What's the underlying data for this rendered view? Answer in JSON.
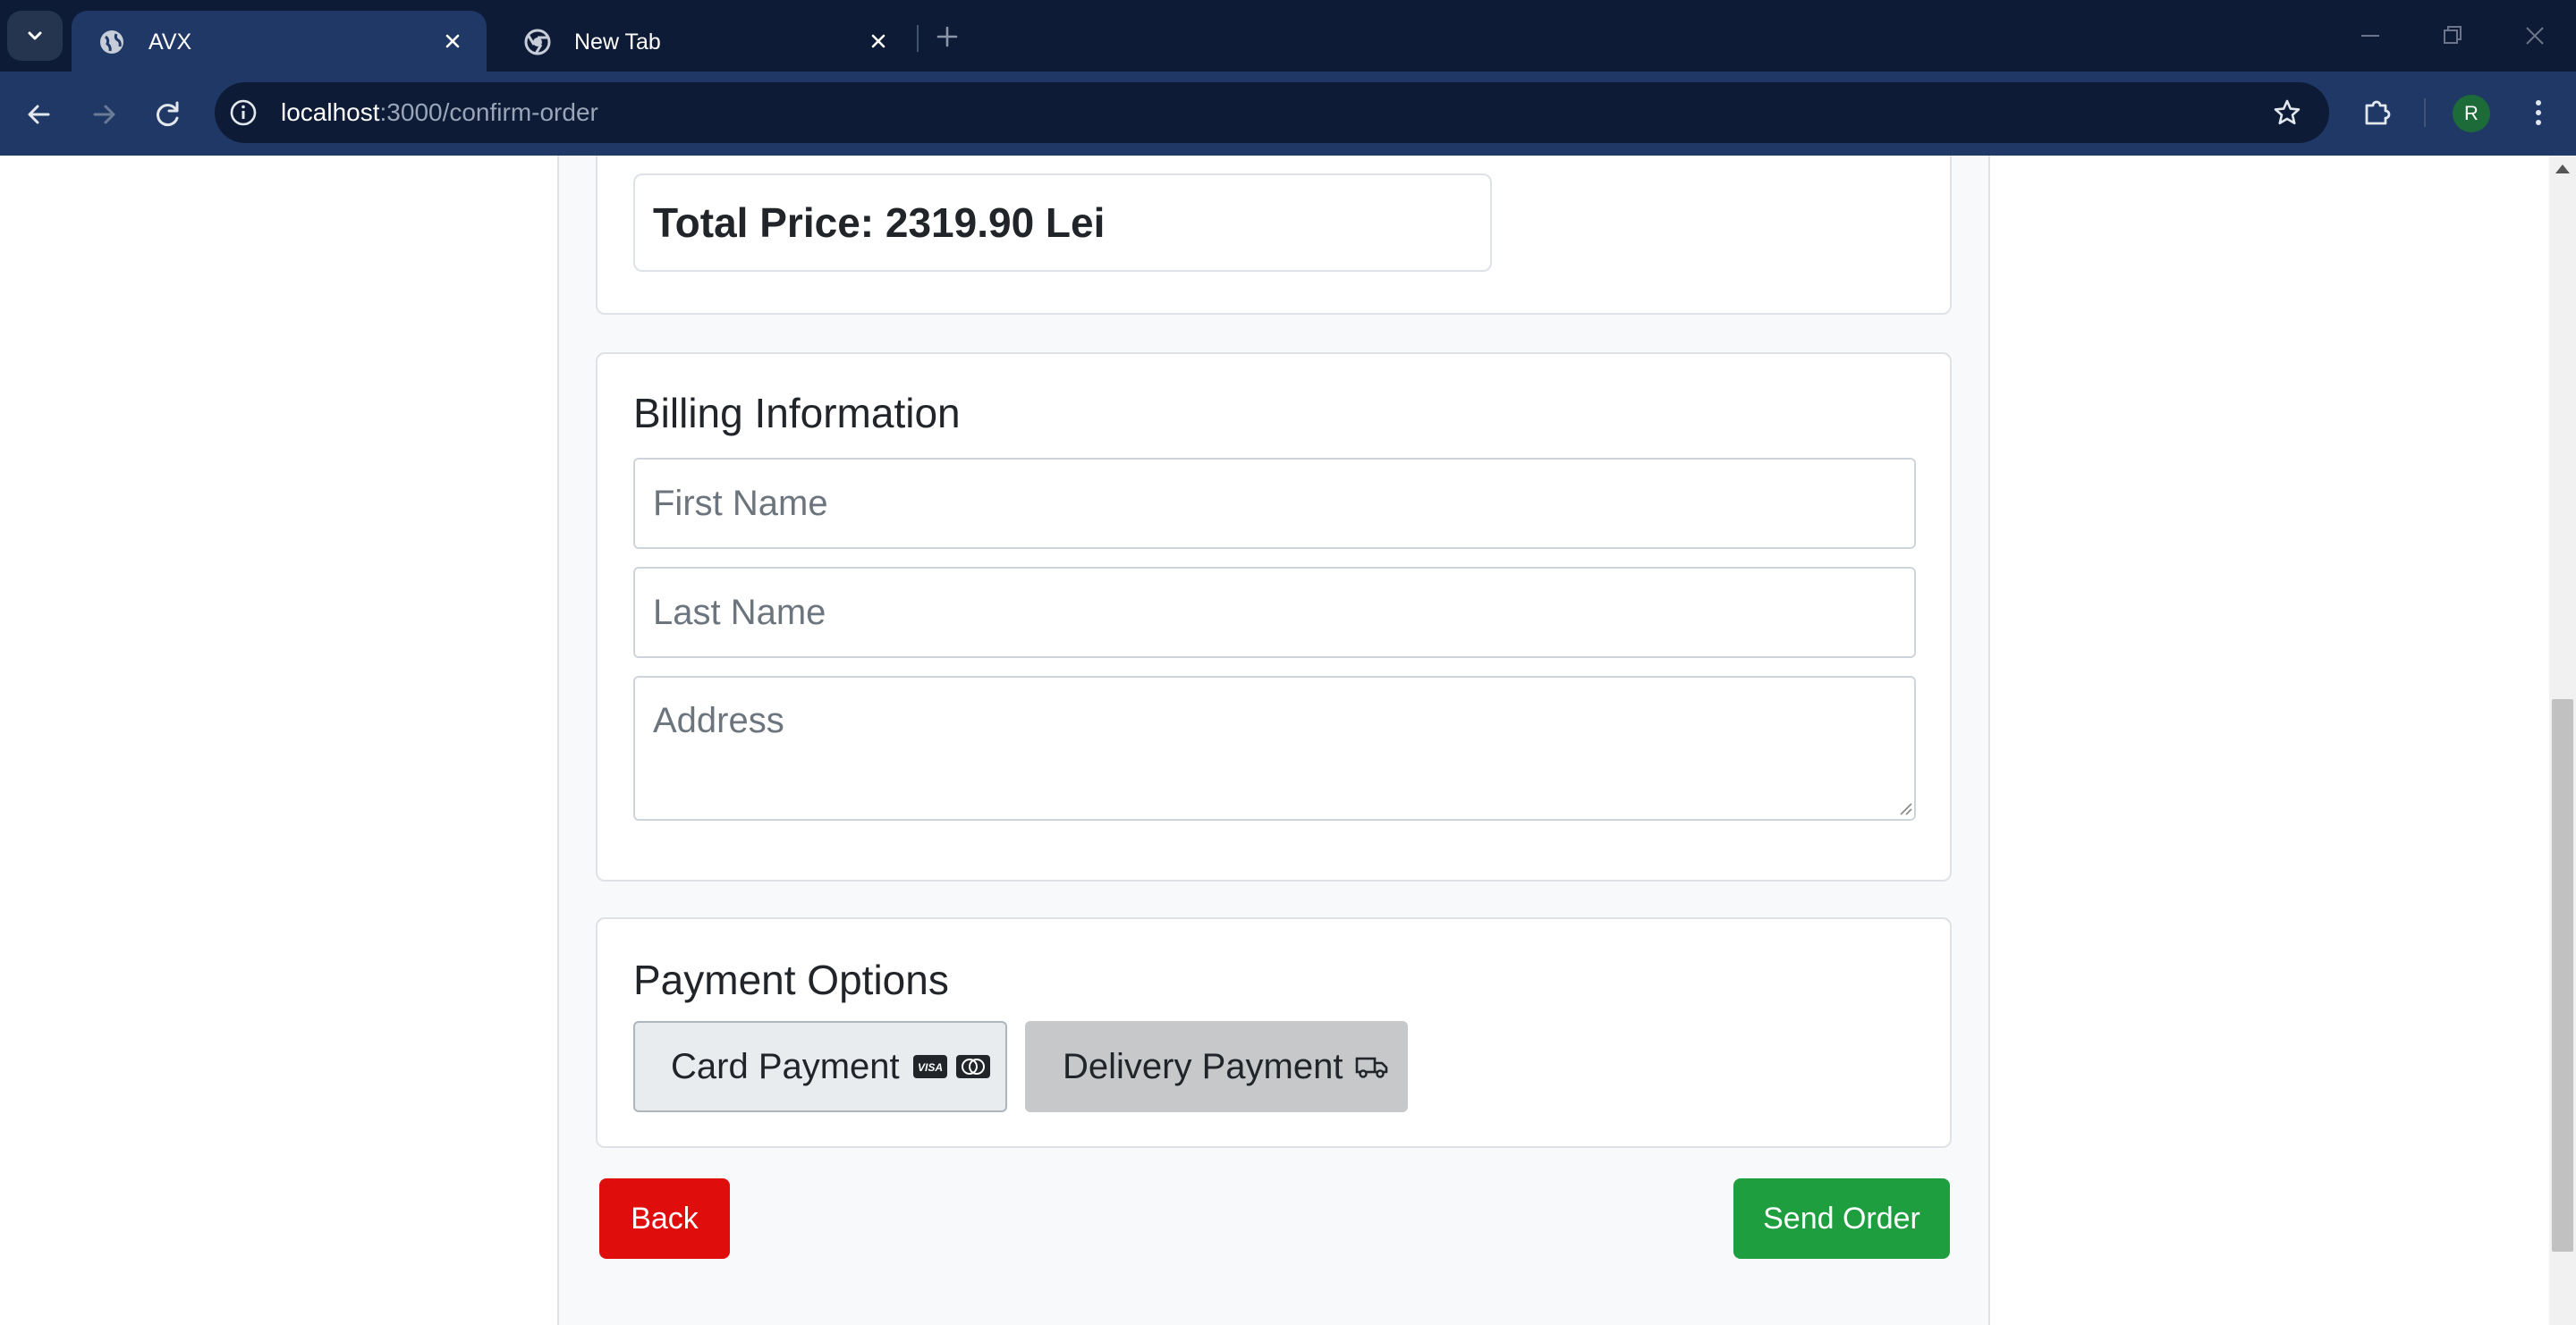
{
  "browser": {
    "tabs": [
      {
        "title": "AVX",
        "active": true,
        "favicon": "globe-icon"
      },
      {
        "title": "New Tab",
        "active": false,
        "favicon": "chrome-icon"
      }
    ],
    "url_host": "localhost",
    "url_path": ":3000/confirm-order",
    "profile_initial": "R"
  },
  "order": {
    "total_price_text": "Total Price: 2319.90 Lei"
  },
  "billing": {
    "title": "Billing Information",
    "first_name_placeholder": "First Name",
    "last_name_placeholder": "Last Name",
    "address_placeholder": "Address"
  },
  "payment": {
    "title": "Payment Options",
    "card_label": "Card Payment",
    "delivery_label": "Delivery Payment",
    "card_icons": [
      "visa-icon",
      "mastercard-icon"
    ],
    "delivery_icon": "truck-icon"
  },
  "actions": {
    "back_label": "Back",
    "send_label": "Send Order"
  },
  "colors": {
    "back": "#e00d0d",
    "send": "#1f9e3f"
  }
}
